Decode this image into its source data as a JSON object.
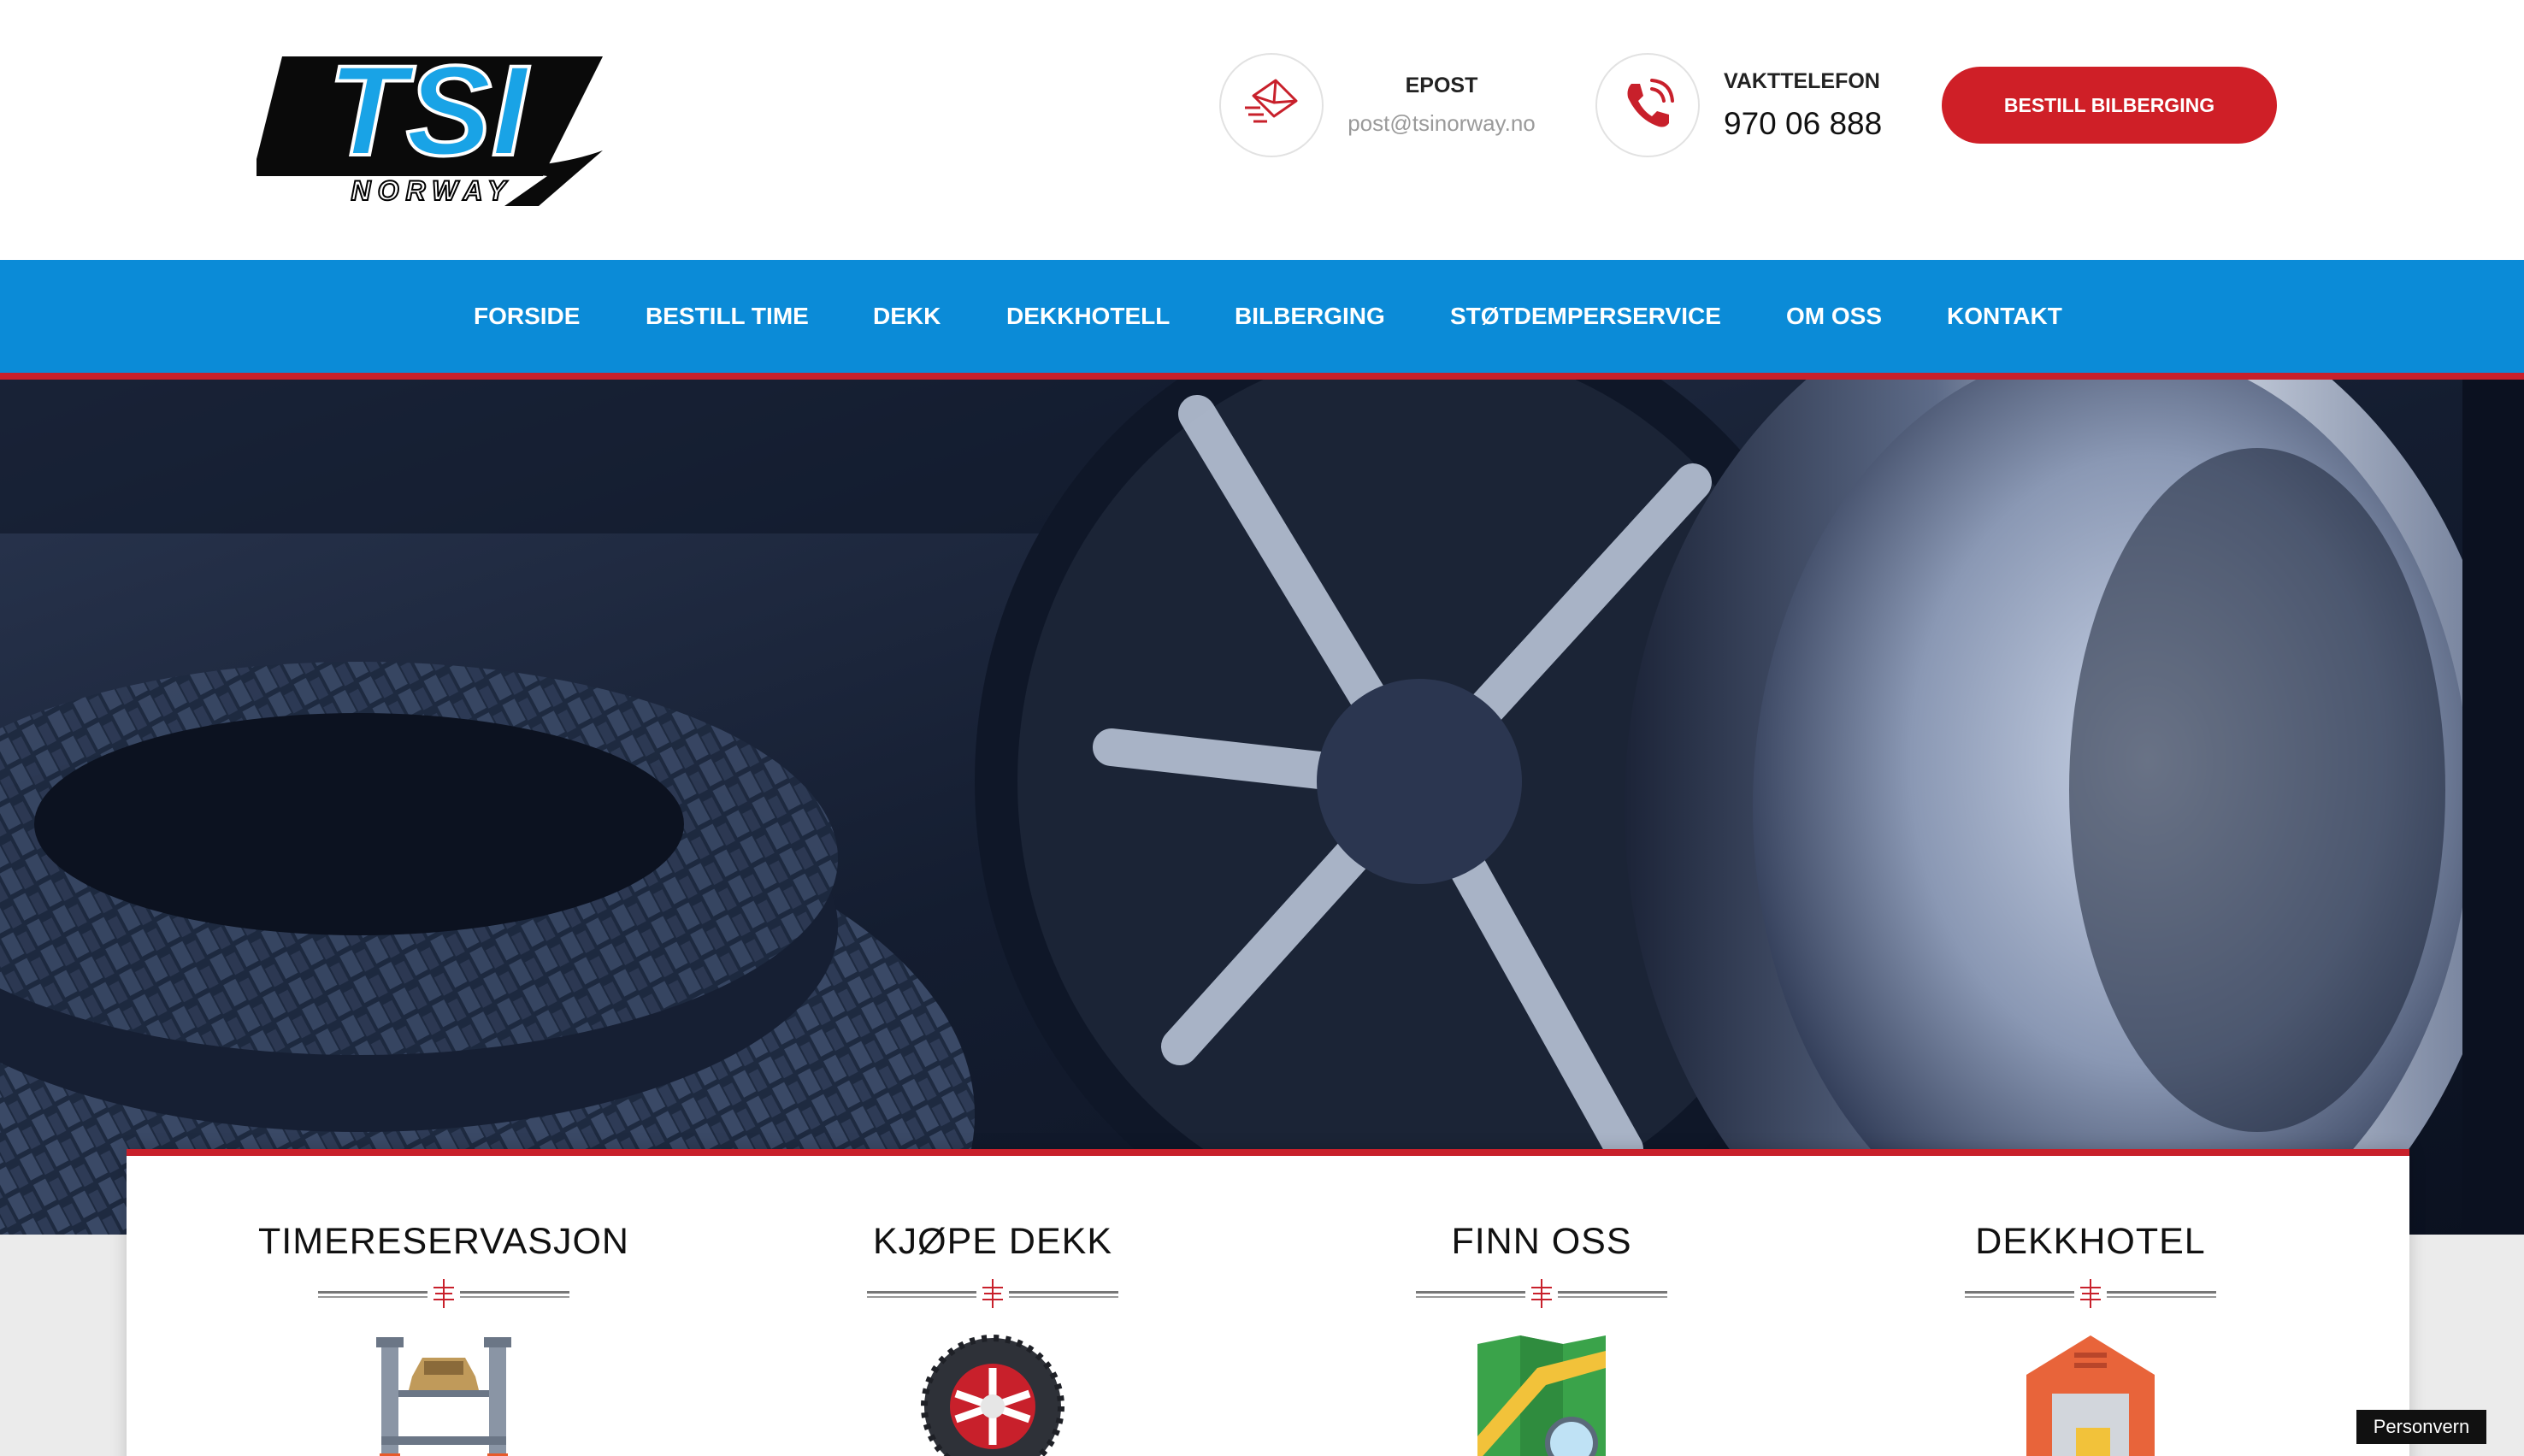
{
  "header": {
    "logo_text": "TSI",
    "logo_subtext": "NORWAY",
    "email": {
      "label": "EPOST",
      "value": "post@tsinorway.no"
    },
    "phone": {
      "label": "VAKTTELEFON",
      "value": "970 06 888"
    },
    "cta_label": "BESTILL BILBERGING"
  },
  "nav": {
    "items": [
      "FORSIDE",
      "BESTILL TIME",
      "DEKK",
      "DEKKHOTELL",
      "BILBERGING",
      "STØTDEMPERSERVICE",
      "OM OSS",
      "KONTAKT"
    ]
  },
  "hero": {
    "subject": "tires and alloy wheels"
  },
  "features": [
    {
      "title": "TIMERESERVASJON",
      "icon": "car-lift-icon"
    },
    {
      "title": "KJØPE DEKK",
      "icon": "tire-icon"
    },
    {
      "title": "FINN OSS",
      "icon": "map-icon"
    },
    {
      "title": "DEKKHOTEL",
      "icon": "garage-icon"
    }
  ],
  "footer": {
    "privacy_label": "Personvern"
  },
  "colors": {
    "brand_blue": "#0b8bd7",
    "brand_red": "#cf1f27",
    "logo_blue": "#19a3e6"
  }
}
